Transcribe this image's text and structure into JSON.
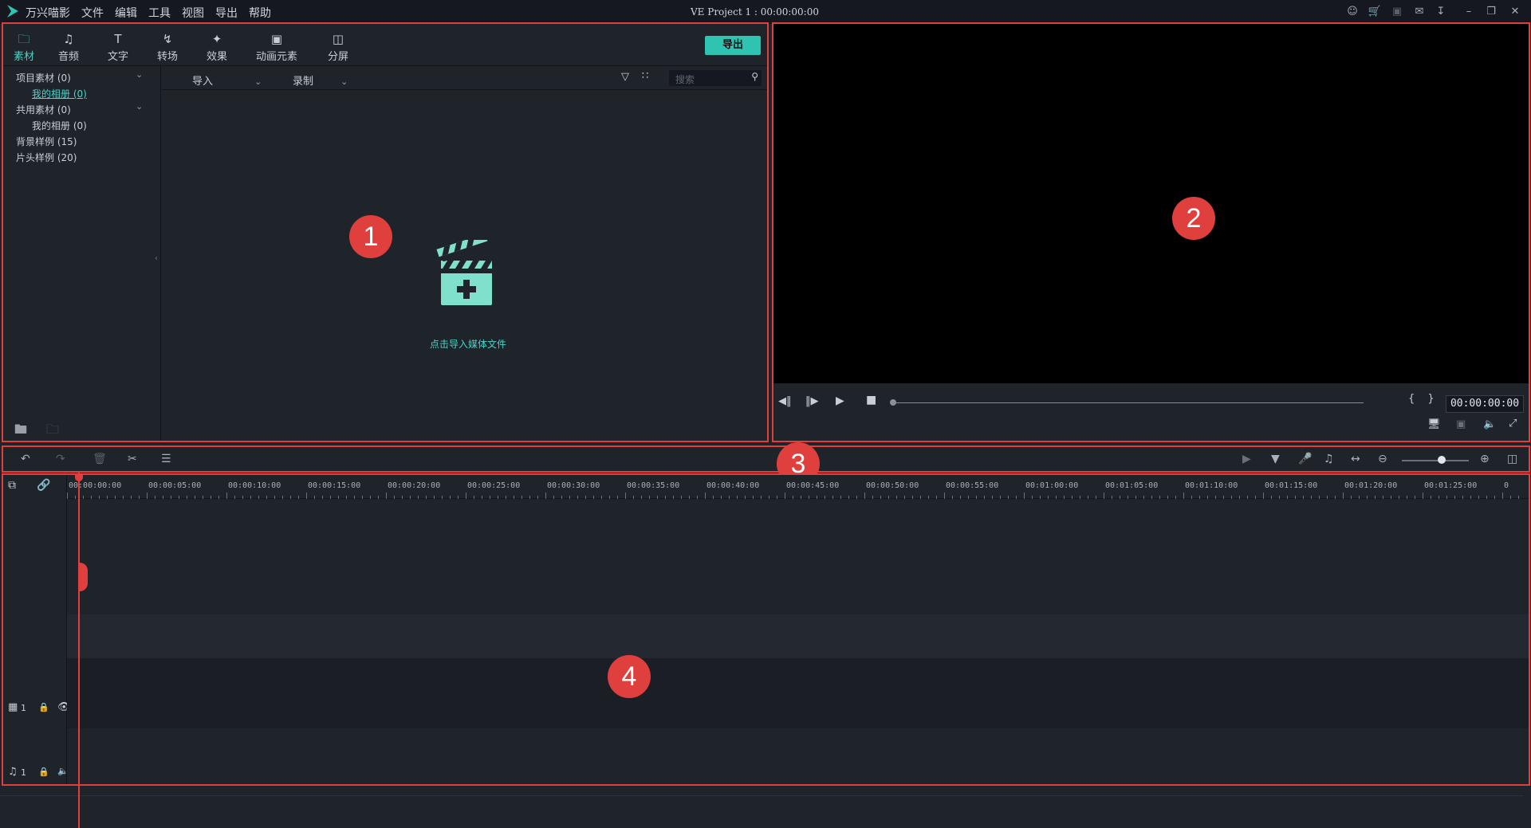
{
  "app": {
    "name": "万兴喵影",
    "project_title": "VE Project 1 : 00:00:00:00"
  },
  "menu": [
    "文件",
    "编辑",
    "工具",
    "视图",
    "导出",
    "帮助"
  ],
  "media_tabs": [
    {
      "label": "素材",
      "icon": "folder-icon",
      "active": true
    },
    {
      "label": "音频",
      "icon": "music-note-icon",
      "active": false
    },
    {
      "label": "文字",
      "icon": "text-icon",
      "active": false
    },
    {
      "label": "转场",
      "icon": "transition-icon",
      "active": false
    },
    {
      "label": "效果",
      "icon": "effects-icon",
      "active": false
    },
    {
      "label": "动画元素",
      "icon": "image-icon",
      "active": false
    },
    {
      "label": "分屏",
      "icon": "split-screen-icon",
      "active": false
    }
  ],
  "export_label": "导出",
  "sidebar": {
    "items": [
      {
        "label": "项目素材 (0)",
        "expandable": true
      },
      {
        "label": "我的相册 (0)",
        "active": true
      },
      {
        "label": "共用素材 (0)",
        "expandable": true
      },
      {
        "label": "我的相册 (0)"
      },
      {
        "label": "背景样例 (15)"
      },
      {
        "label": "片头样例 (20)"
      }
    ]
  },
  "media_subbar": {
    "import_label": "导入",
    "record_label": "录制",
    "search_placeholder": "搜索"
  },
  "empty_hint": "点击导入媒体文件",
  "preview": {
    "timecode": "00:00:00:00",
    "mark_in_out": "{ }"
  },
  "timeline": {
    "ruler_labels": [
      "00:00:00:00",
      "00:00:05:00",
      "00:00:10:00",
      "00:00:15:00",
      "00:00:20:00",
      "00:00:25:00",
      "00:00:30:00",
      "00:00:35:00",
      "00:00:40:00",
      "00:00:45:00",
      "00:00:50:00",
      "00:00:55:00",
      "00:01:00:00",
      "00:01:05:00",
      "00:01:10:00",
      "00:01:15:00",
      "00:01:20:00",
      "00:01:25:00",
      "0"
    ],
    "video_track_label": "1",
    "audio_track_label": "1"
  },
  "callouts": [
    "1",
    "2",
    "3",
    "4"
  ],
  "colors": {
    "accent": "#2fc3b1",
    "highlight_border": "#e0403d",
    "background": "#1f232a"
  }
}
